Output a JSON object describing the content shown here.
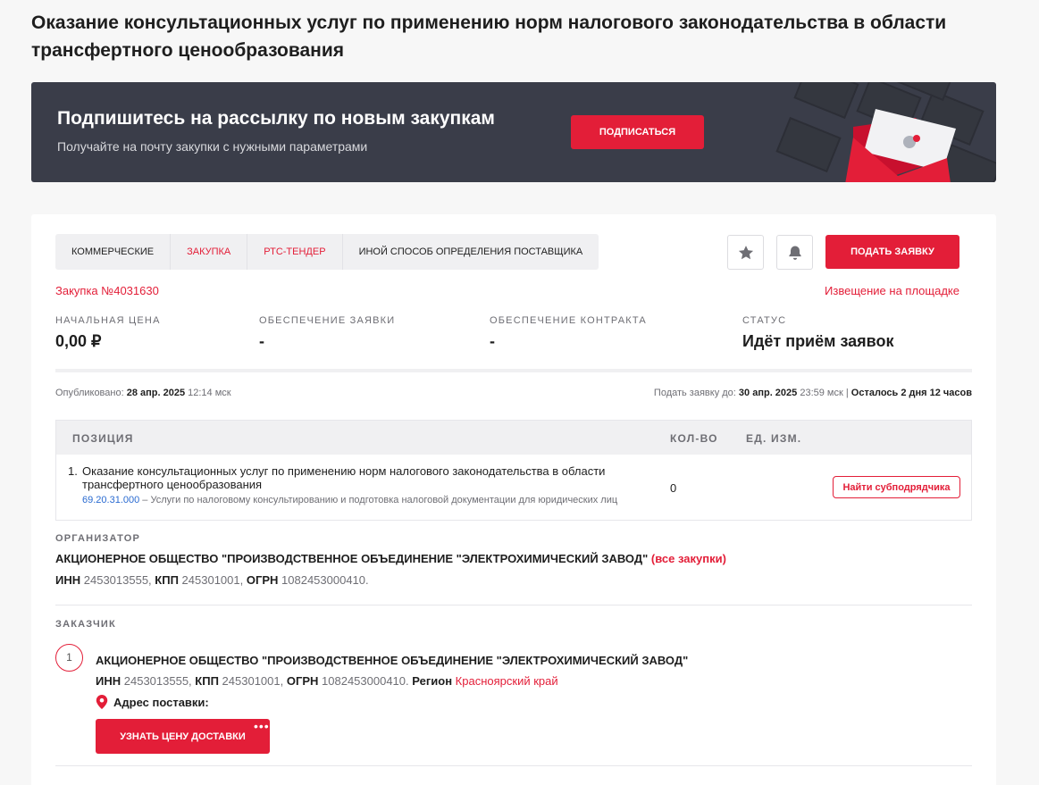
{
  "page_title": "Оказание консультационных услуг по применению норм налогового законодательства в области трансфертного ценообразования",
  "banner": {
    "title": "Подпишитесь на рассылку по новым закупкам",
    "subtitle": "Получайте на почту закупки с нужными параметрами",
    "button": "ПОДПИСАТЬСЯ"
  },
  "tags": [
    "КОММЕРЧЕСКИЕ",
    "ЗАКУПКА",
    "РТС-ТЕНДЕР",
    "ИНОЙ СПОСОБ ОПРЕДЕЛЕНИЯ ПОСТАВЩИКА"
  ],
  "actions": {
    "apply": "ПОДАТЬ ЗАЯВКУ"
  },
  "purchase_number": "Закупка №4031630",
  "notice_link": "Извещение на площадке",
  "stats": [
    {
      "label": "НАЧАЛЬНАЯ ЦЕНА",
      "value": "0,00 ₽"
    },
    {
      "label": "ОБЕСПЕЧЕНИЕ ЗАЯВКИ",
      "value": "-"
    },
    {
      "label": "ОБЕСПЕЧЕНИЕ КОНТРАКТА",
      "value": "-"
    },
    {
      "label": "СТАТУС",
      "value": "Идёт приём заявок"
    }
  ],
  "published": {
    "label": "Опубликовано:",
    "date": "28 апр. 2025",
    "time": "12:14 мск"
  },
  "deadline": {
    "label": "Подать заявку до:",
    "date": "30 апр. 2025",
    "time": "23:59 мск",
    "separator": "|",
    "remaining": "Осталось 2 дня 12 часов"
  },
  "table": {
    "headers": [
      "ПОЗИЦИЯ",
      "КОЛ-ВО",
      "ЕД. ИЗМ."
    ],
    "rows": [
      {
        "num": "1.",
        "name": "Оказание консультационных услуг по применению норм налогового законодательства в области трансфертного ценообразования",
        "code": "69.20.31.000",
        "code_desc": "– Услуги по налоговому консультированию и подготовка налоговой документации для юридических лиц",
        "qty": "0",
        "unit": "",
        "action": "Найти субподрядчика"
      }
    ]
  },
  "organizer": {
    "label": "ОРГАНИЗАТОР",
    "name": "АКЦИОНЕРНОЕ ОБЩЕСТВО \"ПРОИЗВОДСТВЕННОЕ ОБЪЕДИНЕНИЕ \"ЭЛЕКТРОХИМИЧЕСКИЙ ЗАВОД\"",
    "all_link": "(все закупки)",
    "inn_label": "ИНН",
    "inn": "2453013555,",
    "kpp_label": "КПП",
    "kpp": "245301001,",
    "ogrn_label": "ОГРН",
    "ogrn": "1082453000410."
  },
  "customer": {
    "label": "ЗАКАЗЧИК",
    "index": "1",
    "name": "АКЦИОНЕРНОЕ ОБЩЕСТВО \"ПРОИЗВОДСТВЕННОЕ ОБЪЕДИНЕНИЕ \"ЭЛЕКТРОХИМИЧЕСКИЙ ЗАВОД\"",
    "inn_label": "ИНН",
    "inn": "2453013555,",
    "kpp_label": "КПП",
    "kpp": "245301001,",
    "ogrn_label": "ОГРН",
    "ogrn": "1082453000410.",
    "region_label": "Регион",
    "region": "Красноярский край",
    "address_label": "Адрес поставки:",
    "delivery_button": "УЗНАТЬ ЦЕНУ ДОСТАВКИ",
    "more": "•••"
  },
  "colors": {
    "accent": "#e31e38",
    "banner_bg": "#3a3d49",
    "link_blue": "#2a6bd1"
  }
}
